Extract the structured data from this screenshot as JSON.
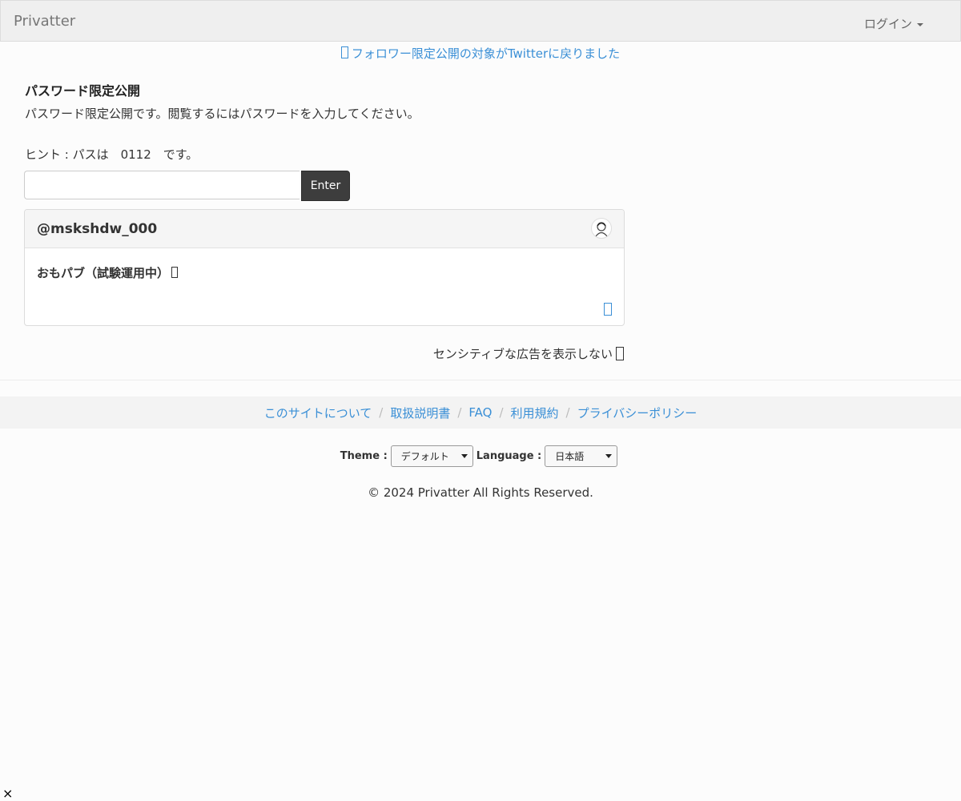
{
  "navbar": {
    "brand": "Privatter",
    "login_label": "ログイン"
  },
  "notice": {
    "text": "フォロワー限定公開の対象がTwitterに戻りました"
  },
  "main": {
    "title": "パスワード限定公開",
    "description": "パスワード限定公開です。閲覧するにはパスワードを入力してください。",
    "hint": "ヒント : パスは　0112　です。",
    "password_value": "",
    "password_placeholder": "",
    "enter_label": "Enter"
  },
  "card": {
    "username": "@mskshdw_000",
    "body": "おもパブ（試験運用中）"
  },
  "sensitive": {
    "label": "センシティブな広告を表示しない"
  },
  "footer": {
    "links": [
      "このサイトについて",
      "取扱説明書",
      "FAQ",
      "利用規約",
      "プライバシーポリシー"
    ],
    "separator": "/",
    "theme_label": "Theme :",
    "theme_value": "デフォルト",
    "language_label": "Language :",
    "language_value": "日本語",
    "copyright": "© 2024 Privatter All Rights Reserved."
  },
  "close": {
    "glyph": "×"
  },
  "colors": {
    "link": "#3a8fd6",
    "enter_button": "#3d3d3d",
    "navbar": "#efefef"
  }
}
